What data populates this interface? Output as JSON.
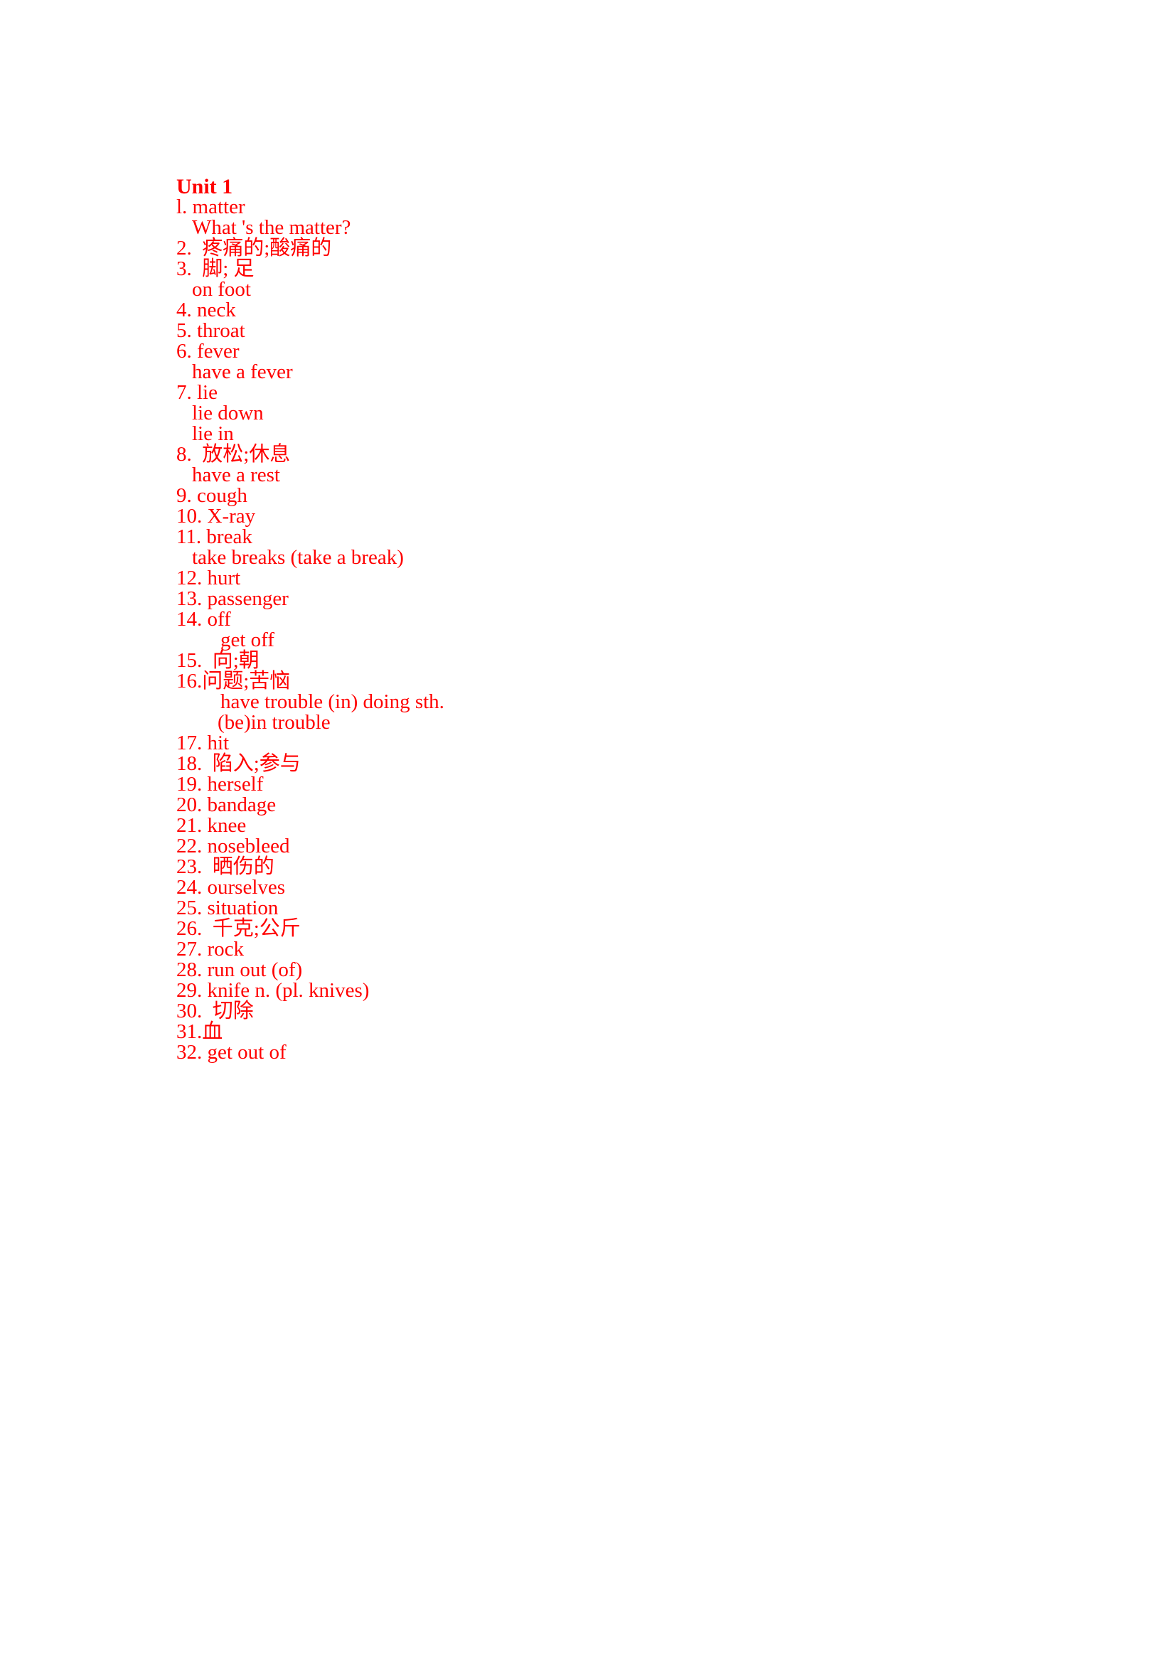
{
  "page": {
    "title": "Unit 1",
    "text_color": "#ff0000",
    "background_color": "#ffffff"
  },
  "entries": [
    {
      "text": "l. matter",
      "indent": "lvl0"
    },
    {
      "text": "What 's the matter?",
      "indent": "lvl1"
    },
    {
      "text": "2.  疼痛的;酸痛的",
      "indent": "lvl0"
    },
    {
      "text": "3.  脚; 足",
      "indent": "lvl0"
    },
    {
      "text": "on foot",
      "indent": "lvl1"
    },
    {
      "text": "4. neck",
      "indent": "lvl0"
    },
    {
      "text": "5. throat",
      "indent": "lvl0"
    },
    {
      "text": "6. fever",
      "indent": "lvl0"
    },
    {
      "text": "have a fever",
      "indent": "lvl1"
    },
    {
      "text": "7. lie",
      "indent": "lvl0"
    },
    {
      "text": "lie down",
      "indent": "lvl1"
    },
    {
      "text": "lie in",
      "indent": "lvl1"
    },
    {
      "text": "8.  放松;休息",
      "indent": "lvl0"
    },
    {
      "text": "have a rest",
      "indent": "lvl1"
    },
    {
      "text": "9. cough",
      "indent": "lvl0"
    },
    {
      "text": "10. X-ray",
      "indent": "lvl0"
    },
    {
      "text": "11. break",
      "indent": "lvl0"
    },
    {
      "text": "take breaks (take a break)",
      "indent": "lvl1"
    },
    {
      "text": "12. hurt",
      "indent": "lvl0"
    },
    {
      "text": "13. passenger",
      "indent": "lvl0"
    },
    {
      "text": "14. off",
      "indent": "lvl0"
    },
    {
      "text": "get off",
      "indent": "lvl2"
    },
    {
      "text": "15.  向;朝",
      "indent": "lvl0"
    },
    {
      "text": "16.问题;苦恼",
      "indent": "lvl0"
    },
    {
      "text": "have trouble (in) doing sth.",
      "indent": "lvl2"
    },
    {
      "text": "(be)in trouble",
      "indent": "lvl2b"
    },
    {
      "text": "17. hit",
      "indent": "lvl0"
    },
    {
      "text": "18.  陷入;参与",
      "indent": "lvl0"
    },
    {
      "text": "19. herself",
      "indent": "lvl0"
    },
    {
      "text": "20. bandage",
      "indent": "lvl0"
    },
    {
      "text": "21. knee",
      "indent": "lvl0"
    },
    {
      "text": "22. nosebleed",
      "indent": "lvl0"
    },
    {
      "text": "23.  晒伤的",
      "indent": "lvl0"
    },
    {
      "text": "24. ourselves",
      "indent": "lvl0"
    },
    {
      "text": "25. situation",
      "indent": "lvl0"
    },
    {
      "text": "26.  千克;公斤",
      "indent": "lvl0"
    },
    {
      "text": "27. rock",
      "indent": "lvl0"
    },
    {
      "text": "28. run out (of)",
      "indent": "lvl0"
    },
    {
      "text": "29. knife n. (pl. knives)",
      "indent": "lvl0"
    },
    {
      "text": "30.  切除",
      "indent": "lvl0"
    },
    {
      "text": "31.血",
      "indent": "lvl0"
    },
    {
      "text": "32. get out of",
      "indent": "lvl0"
    }
  ]
}
